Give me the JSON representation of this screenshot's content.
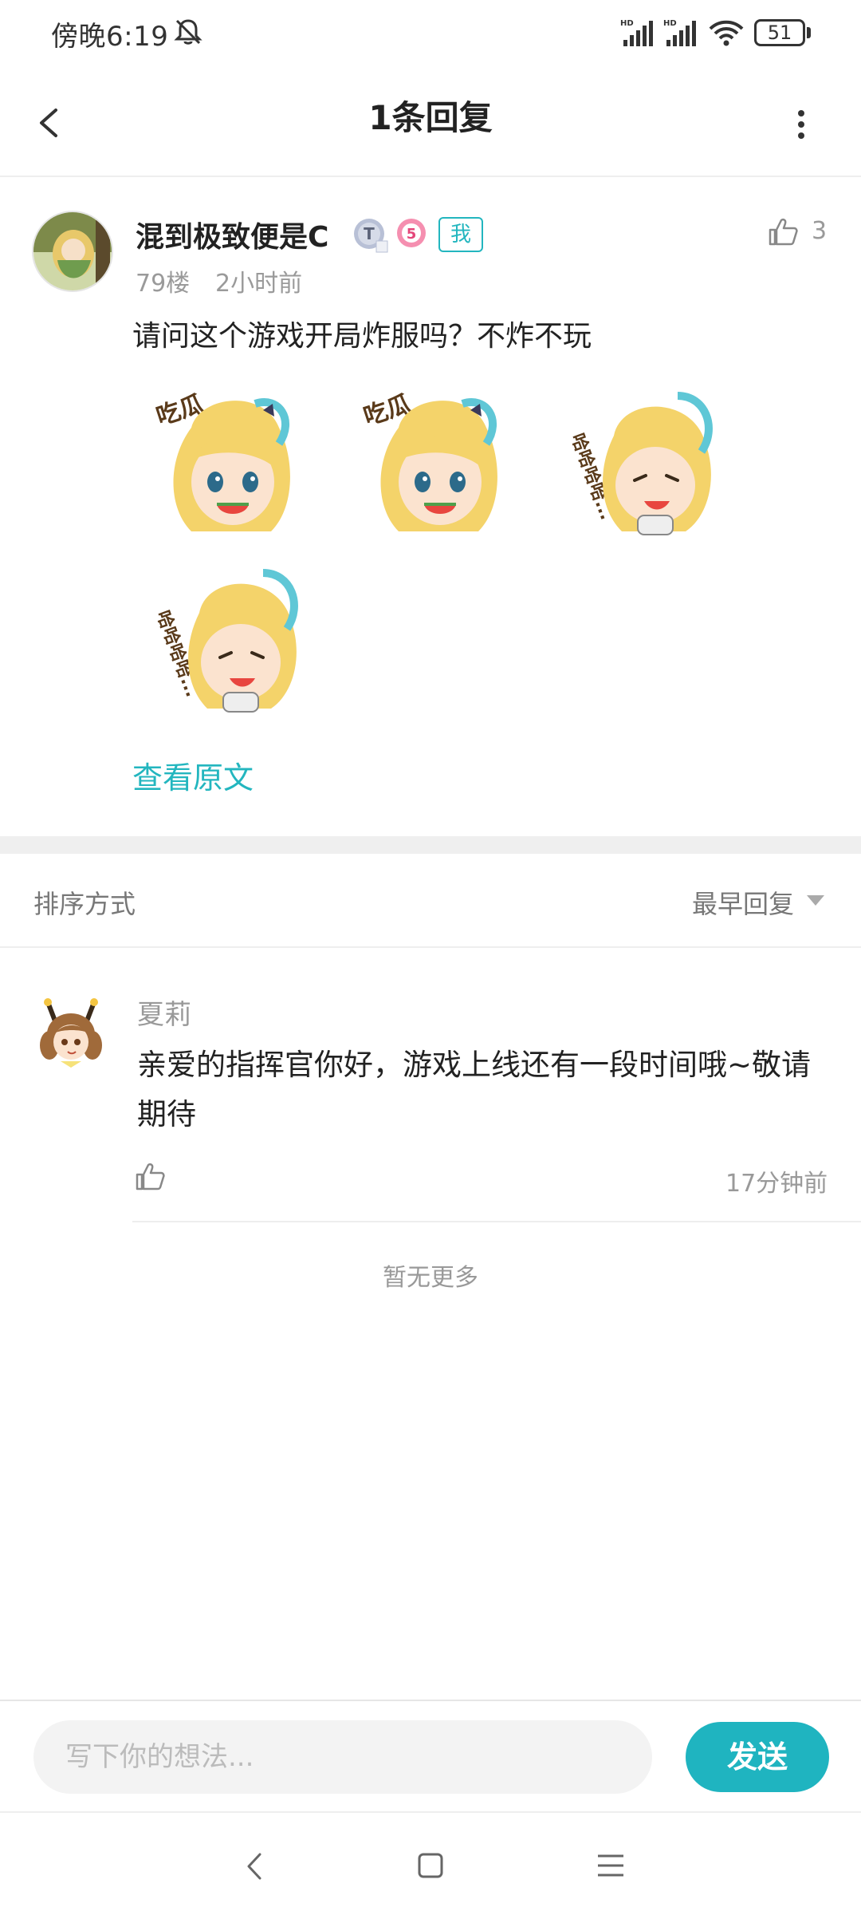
{
  "status_bar": {
    "time": "傍晚6:19",
    "battery_level": "51",
    "icons": [
      "bell-off-icon",
      "signal-hd-icon",
      "signal-hd-icon",
      "wifi-icon",
      "battery-icon"
    ]
  },
  "header": {
    "title": "1条回复",
    "back_icon": "chevron-left-icon",
    "more_icon": "more-vertical-icon"
  },
  "post": {
    "username": "混到极致便是C",
    "badges": [
      "T",
      "5",
      "我"
    ],
    "floor": "79楼",
    "time": "2小时前",
    "like_count": "3",
    "text": "请问这个游戏开局炸服吗？不炸不玩",
    "stickers": [
      "吃瓜",
      "吃瓜",
      "哈哈哈哈...",
      "哈哈哈哈..."
    ],
    "view_original": "查看原文"
  },
  "sort": {
    "label": "排序方式",
    "value": "最早回复"
  },
  "reply": {
    "name": "夏莉",
    "text": "亲爱的指挥官你好，游戏上线还有一段时间哦~敬请期待",
    "time": "17分钟前"
  },
  "footer_note": "暂无更多",
  "input": {
    "placeholder": "写下你的想法...",
    "send_label": "发送"
  },
  "colors": {
    "accent": "#1fb4c0",
    "text_primary": "#222222",
    "text_secondary": "#999999",
    "divider": "#eeeeee"
  }
}
